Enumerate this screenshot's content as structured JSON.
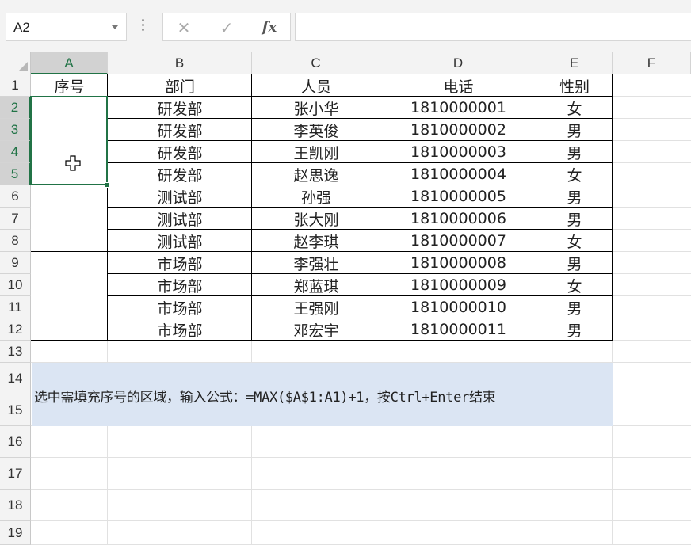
{
  "name_box": {
    "value": "A2"
  },
  "formula_bar": {
    "cancel_icon": "✕",
    "enter_icon": "✓",
    "fx_label": "fx",
    "value": ""
  },
  "columns": [
    "A",
    "B",
    "C",
    "D",
    "E",
    "F"
  ],
  "rows": [
    "1",
    "2",
    "3",
    "4",
    "5",
    "6",
    "7",
    "8",
    "9",
    "10",
    "11",
    "12",
    "13",
    "14",
    "15",
    "16",
    "17",
    "18",
    "19"
  ],
  "table": {
    "headers": [
      "序号",
      "部门",
      "人员",
      "电话",
      "性别"
    ],
    "dept": [
      "研发部",
      "研发部",
      "研发部",
      "研发部",
      "测试部",
      "测试部",
      "测试部",
      "市场部",
      "市场部",
      "市场部",
      "市场部"
    ],
    "person": [
      "张小华",
      "李英俊",
      "王凯刚",
      "赵思逸",
      "孙强",
      "张大刚",
      "赵李琪",
      "李强壮",
      "郑蓝琪",
      "王强刚",
      "邓宏宇"
    ],
    "phone": [
      "1810000001",
      "1810000002",
      "1810000003",
      "1810000004",
      "1810000005",
      "1810000006",
      "1810000007",
      "1810000008",
      "1810000009",
      "1810000010",
      "1810000011"
    ],
    "gender": [
      "女",
      "男",
      "男",
      "女",
      "男",
      "男",
      "女",
      "男",
      "女",
      "男",
      "男"
    ]
  },
  "note": {
    "text": "选中需填充序号的区域，输入公式：=MAX($A$1:A1)+1，按Ctrl+Enter结束"
  },
  "colors": {
    "accent": "#217346",
    "note_fill": "#dbe5f3",
    "header_bg": "#f3f3f3"
  }
}
